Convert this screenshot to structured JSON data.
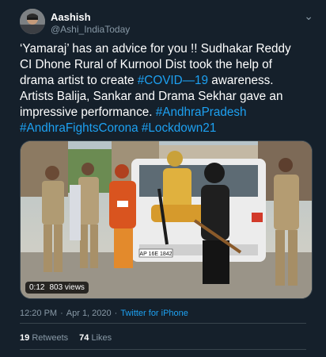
{
  "tweet": {
    "author": {
      "name": "Aashish",
      "handle": "@Ashi_IndiaToday"
    },
    "text_segments": [
      {
        "text": "‘Yamaraj’ has an advice for you !! Sudhakar Reddy CI Dhone Rural of Kurnool Dist took the help of drama artist to create  ",
        "type": "text"
      },
      {
        "text": "#COVID—19",
        "type": "link"
      },
      {
        "text": " awareness. Artists Balija, Sankar and Drama Sekhar gave an impressive performance. ",
        "type": "text"
      },
      {
        "text": "#AndhraPradesh",
        "type": "link"
      },
      {
        "text": " ",
        "type": "text"
      },
      {
        "text": "#AndhraFightsCorona",
        "type": "link"
      },
      {
        "text": " ",
        "type": "text"
      },
      {
        "text": "#Lockdown21",
        "type": "link"
      }
    ],
    "media": {
      "duration": "0:12",
      "views": "803 views",
      "plate_text": "AP 16E 1842"
    },
    "time": "12:20 PM",
    "date": "Apr 1, 2020",
    "source": "Twitter for iPhone",
    "retweets": {
      "count": "19",
      "label": "Retweets"
    },
    "likes": {
      "count": "74",
      "label": "Likes"
    }
  },
  "colors": {
    "background": "#15202b",
    "link": "#1da1f2",
    "muted": "#8899a6",
    "border": "#38444d"
  },
  "icons": {
    "menu": "chevron-down-icon"
  }
}
